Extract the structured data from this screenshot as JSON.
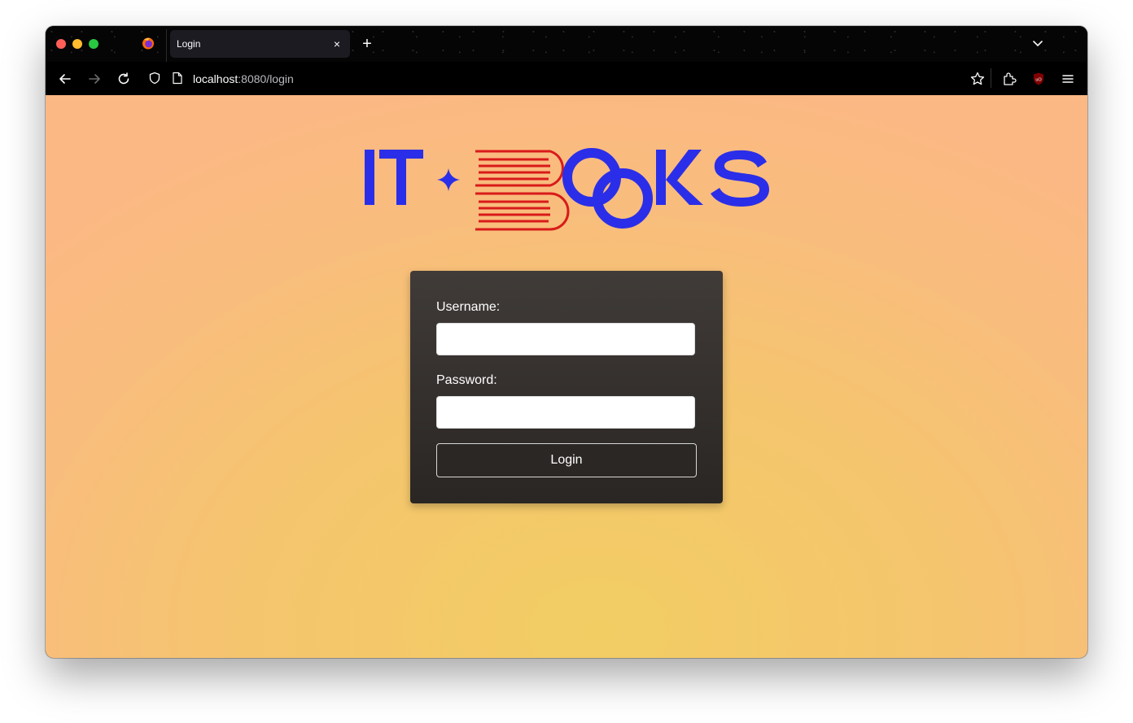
{
  "browser": {
    "tab": {
      "title": "Login",
      "close_glyph": "×"
    },
    "new_tab_glyph": "+",
    "url": {
      "host": "localhost",
      "rest": ":8080/login"
    },
    "icons": [
      "firefox-icon",
      "tab-list-chevron-icon",
      "back-arrow-icon",
      "forward-arrow-icon",
      "reload-icon",
      "tracking-shield-icon",
      "page-icon",
      "bookmark-star-icon",
      "extensions-icon",
      "ublock-origin-icon",
      "hamburger-menu-icon"
    ]
  },
  "logo": {
    "text": "IT BOOKS",
    "brand_blue": "#2b2ee8",
    "book_red": "#d91a1a"
  },
  "login_form": {
    "username_label": "Username:",
    "username_value": "",
    "password_label": "Password:",
    "password_value": "",
    "submit_label": "Login"
  },
  "colors": {
    "page_gradient_center": "#f2cd63",
    "page_gradient_edge": "#fcb884",
    "card_background": "#2a2624",
    "accent_blue": "#2b2ee8"
  }
}
